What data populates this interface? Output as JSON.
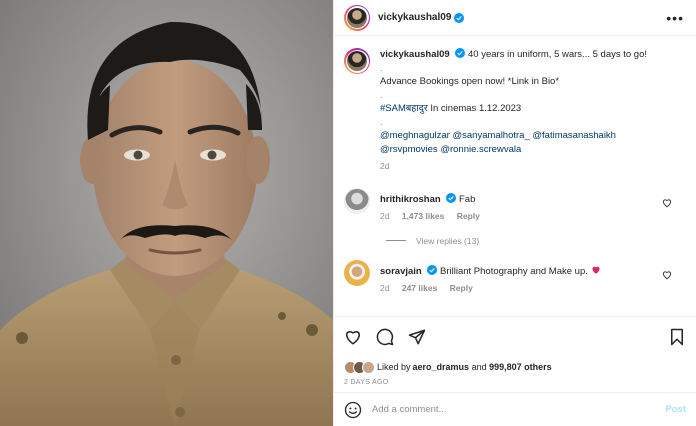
{
  "post": {
    "username": "vickykaushal09",
    "more_label": "•••",
    "caption": {
      "username": "vickykaushal09",
      "line1": "40 years in uniform, 5 wars... 5 days to go!",
      "dot1": ".",
      "line2": "Advance Bookings open now! *Link in Bio*",
      "dot2": ".",
      "hashtag": "#SAMबहादुर",
      "line3_rest": " In cinemas 1.12.2023",
      "dot3": ".",
      "mentions": [
        "@meghnagulzar",
        "@sanyamalhotra_",
        "@fatimasanashaikh",
        "@rsvpmovies",
        "@ronnie.screwvala"
      ],
      "time": "2d"
    },
    "comments": [
      {
        "username": "hrithikroshan",
        "text": "Fab",
        "time": "2d",
        "likes": "1,473 likes",
        "reply": "Reply",
        "view_replies": "View replies (13)"
      },
      {
        "username": "soravjain",
        "text": "Brilliant Photography and Make up.",
        "time": "2d",
        "likes": "247 likes",
        "reply": "Reply"
      }
    ],
    "liked_by_prefix": "Liked by ",
    "liked_by_user": "aero_dramus",
    "liked_by_and": " and ",
    "liked_by_count": "999,807 others",
    "posted_ago": "2 DAYS AGO",
    "add_comment_placeholder": "Add a comment...",
    "post_button": "Post",
    "colors": {
      "heart_red": "#ed4956",
      "link_blue": "#00376b",
      "muted": "#8e8e8e",
      "post_disabled": "#b2dffc"
    },
    "icons": [
      "heart-icon",
      "comment-icon",
      "share-icon",
      "bookmark-icon",
      "emoji-icon",
      "verified-icon",
      "more-icon"
    ]
  }
}
